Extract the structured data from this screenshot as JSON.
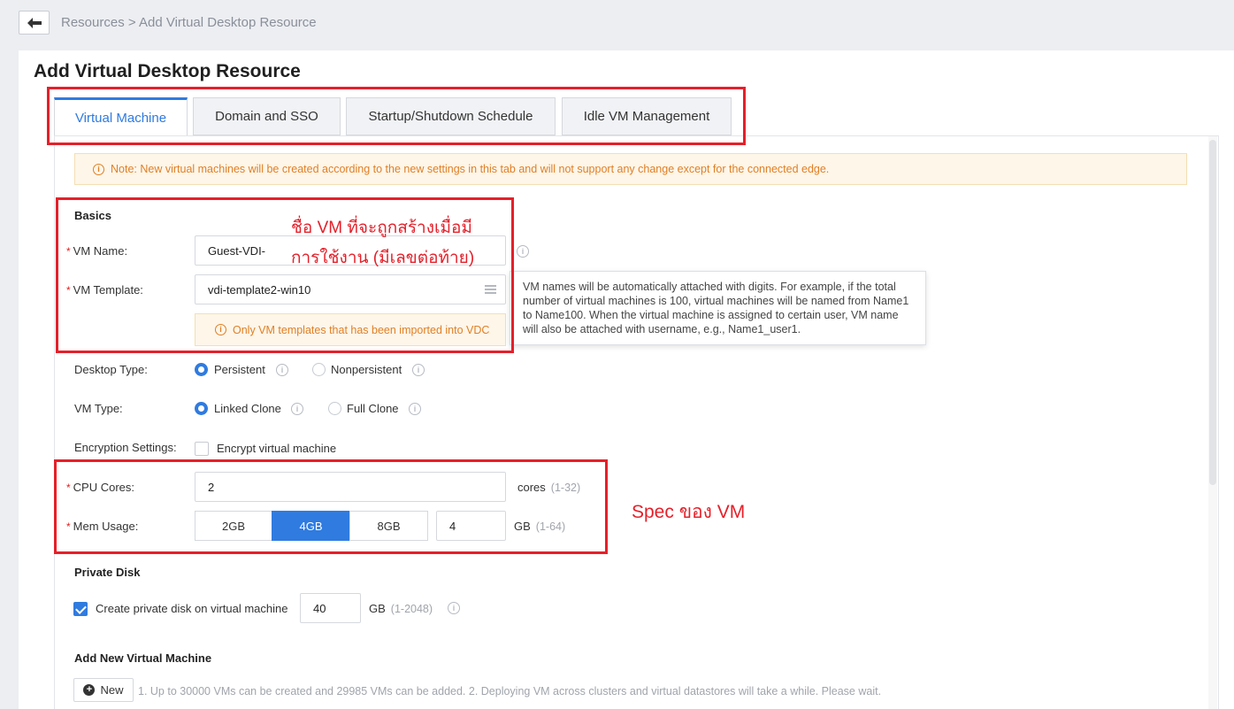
{
  "breadcrumb": {
    "root": "Resources",
    "sep": " > ",
    "current": "Add Virtual Desktop Resource"
  },
  "page_title": "Add Virtual Desktop Resource",
  "tabs": [
    {
      "label": "Virtual Machine",
      "active": true
    },
    {
      "label": "Domain and SSO",
      "active": false
    },
    {
      "label": "Startup/Shutdown Schedule",
      "active": false
    },
    {
      "label": "Idle VM Management",
      "active": false
    }
  ],
  "note": "Note: New virtual machines will be created according to the new settings in this tab and will not support any change except for the connected edge.",
  "basics": {
    "title": "Basics",
    "vm_name_label": "VM Name:",
    "vm_name_value": "Guest-VDI-",
    "vm_template_label": "VM Template:",
    "vm_template_value": "vdi-template2-win10",
    "template_tip": "Only VM templates that has been imported into VDC"
  },
  "tooltip": "VM names will be automatically attached with digits. For example, if the total number of virtual machines is 100, virtual machines will be named from Name1 to Name100. When the virtual machine is assigned to certain user, VM name will also be attached with username, e.g., Name1_user1.",
  "desktop_type": {
    "label": "Desktop Type:",
    "options": [
      "Persistent",
      "Nonpersistent"
    ],
    "selected": "Persistent"
  },
  "vm_type": {
    "label": "VM Type:",
    "options": [
      "Linked Clone",
      "Full Clone"
    ],
    "selected": "Linked Clone"
  },
  "encryption": {
    "label": "Encryption Settings:",
    "option": "Encrypt virtual machine",
    "checked": false
  },
  "cpu": {
    "label": "CPU Cores:",
    "value": "2",
    "unit": "cores",
    "range": "(1-32)"
  },
  "mem": {
    "label": "Mem Usage:",
    "options": [
      "2GB",
      "4GB",
      "8GB"
    ],
    "selected": "4GB",
    "value": "4",
    "unit": "GB",
    "range": "(1-64)"
  },
  "private_disk": {
    "title": "Private Disk",
    "option": "Create private disk on virtual machine",
    "checked": true,
    "value": "40",
    "unit": "GB",
    "range": "(1-2048)"
  },
  "add_vm": {
    "title": "Add New Virtual Machine",
    "button": "New",
    "hint": "1. Up to 30000 VMs can be created and 29985 VMs can be added. 2. Deploying VM across clusters and virtual datastores will take a while. Please wait."
  },
  "annotations": {
    "vm_name_line1": "ชื่อ VM ที่จะถูกสร้างเมื่อมี",
    "vm_name_line2": "การใช้งาน (มีเลขต่อท้าย)",
    "spec": "Spec ของ VM"
  },
  "colors": {
    "accent": "#2f7be0",
    "warning": "#e17f24",
    "annotation": "#e5202a"
  }
}
